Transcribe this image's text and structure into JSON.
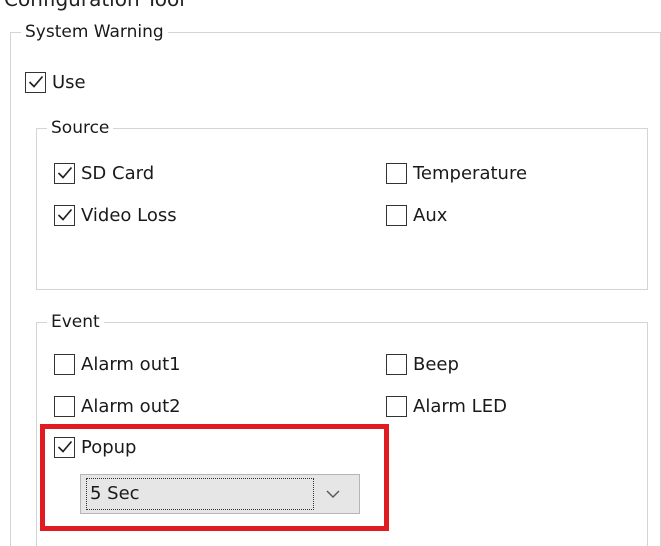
{
  "window": {
    "title": "Configuration Tool"
  },
  "system_warning": {
    "title": "System Warning",
    "use": {
      "label": "Use",
      "checked": true
    }
  },
  "source": {
    "title": "Source",
    "items": [
      {
        "label": "SD Card",
        "checked": true
      },
      {
        "label": "Video Loss",
        "checked": true
      },
      {
        "label": "Temperature",
        "checked": false
      },
      {
        "label": "Aux",
        "checked": false
      }
    ]
  },
  "event": {
    "title": "Event",
    "items": [
      {
        "label": "Alarm out1",
        "checked": false
      },
      {
        "label": "Alarm out2",
        "checked": false
      },
      {
        "label": "Beep",
        "checked": false
      },
      {
        "label": "Alarm LED",
        "checked": false
      }
    ],
    "popup": {
      "label": "Popup",
      "checked": true
    },
    "popup_duration": {
      "selected": "5 Sec"
    }
  },
  "colors": {
    "highlight": "#e11b22",
    "groupbox_border": "#d4d4d4",
    "select_bg": "#e6e6e6"
  }
}
